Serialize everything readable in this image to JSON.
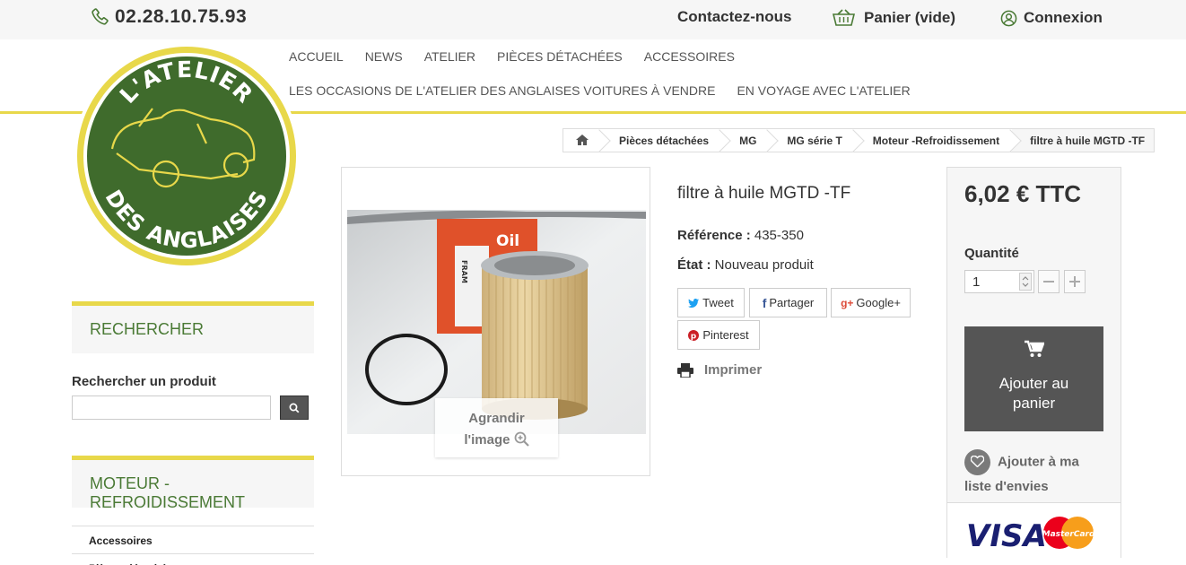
{
  "topbar": {
    "phone": "02.28.10.75.93",
    "contact": "Contactez-nous",
    "cart": "Panier (vide)",
    "login": "Connexion"
  },
  "logo": {
    "top_text": "L'ATELIER",
    "bottom_text": "DES ANGLAISES"
  },
  "nav": {
    "items": [
      "ACCUEIL",
      "NEWS",
      "ATELIER",
      "PIÈCES DÉTACHÉES",
      "ACCESSOIRES",
      "LES OCCASIONS DE L'ATELIER DES ANGLAISES",
      "VOITURES À VENDRE",
      "EN VOYAGE AVEC L'ATELIER"
    ]
  },
  "sidebar": {
    "search_title": "RECHERCHER",
    "search_label": "Rechercher un produit",
    "search_value": "",
    "category_title": "MOTEUR -REFROIDISSEMENT",
    "categories": [
      "Accessoires",
      "Pièces détachées"
    ]
  },
  "breadcrumb": [
    "Pièces détachées",
    "MG",
    "MG série T",
    "Moteur -Refroidissement",
    "filtre à huile MGTD -TF"
  ],
  "product": {
    "title": "filtre à huile MGTD -TF",
    "ref_label": "Référence :",
    "ref_value": "435-350",
    "state_label": "État :",
    "state_value": "Nouveau produit",
    "enlarge_line1": "Agrandir",
    "enlarge_line2": "l'image",
    "box_brand": "FRAM",
    "box_word": "Oil"
  },
  "share": {
    "tweet": "Tweet",
    "facebook": "Partager",
    "google": "Google+",
    "pinterest": "Pinterest",
    "print": "Imprimer"
  },
  "buy": {
    "price": "6,02 € TTC",
    "qty_label": "Quantité",
    "qty_value": "1",
    "add_line1": "Ajouter au",
    "add_line2": "panier",
    "wish_line1": "Ajouter à ma",
    "wish_line2": "liste d'envies",
    "visa": "VISA",
    "mastercard": "MasterCard"
  },
  "colors": {
    "accent_yellow": "#e8d84a",
    "brand_green": "#3f6b2c",
    "dark_button": "#555555"
  }
}
